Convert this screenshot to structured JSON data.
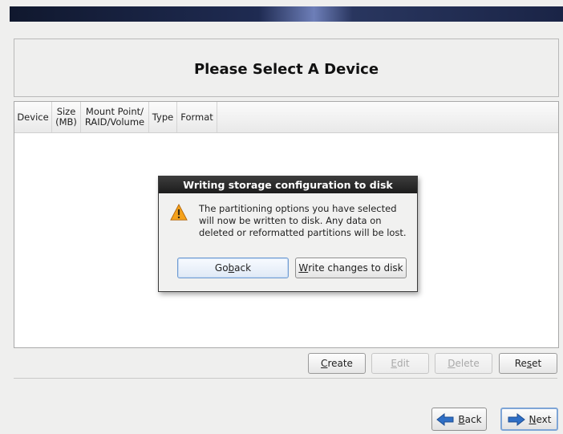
{
  "header": {
    "title": "Please Select A Device"
  },
  "table": {
    "columns": [
      {
        "line1": "Device",
        "line2": ""
      },
      {
        "line1": "Size",
        "line2": "(MB)"
      },
      {
        "line1": "Mount Point/",
        "line2": "RAID/Volume"
      },
      {
        "line1": "Type",
        "line2": ""
      },
      {
        "line1": "Format",
        "line2": ""
      }
    ],
    "rows": []
  },
  "actions": {
    "create": {
      "pre": "",
      "accel": "C",
      "post": "reate"
    },
    "edit": {
      "pre": "",
      "accel": "E",
      "post": "dit"
    },
    "delete": {
      "pre": "",
      "accel": "D",
      "post": "elete"
    },
    "reset": {
      "pre": "Re",
      "accel": "s",
      "post": "et"
    }
  },
  "nav": {
    "back": {
      "pre": "",
      "accel": "B",
      "post": "ack"
    },
    "next": {
      "pre": "",
      "accel": "N",
      "post": "ext"
    }
  },
  "dialog": {
    "title": "Writing storage configuration to disk",
    "message": "The partitioning options you have selected\nwill now be written to disk.  Any data on\ndeleted or reformatted partitions will be lost.",
    "go_back": {
      "pre": "Go ",
      "accel": "b",
      "post": "ack"
    },
    "write": {
      "pre": "",
      "accel": "W",
      "post": "rite changes to disk"
    }
  },
  "colors": {
    "warning": "#f5a21b",
    "accent_blue": "#2f6fc6"
  }
}
